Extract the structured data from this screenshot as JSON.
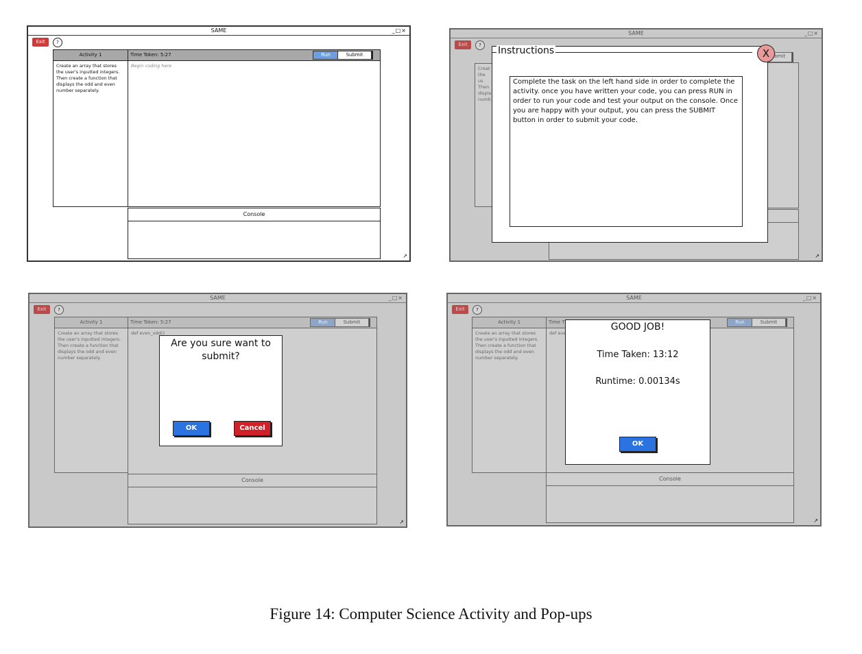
{
  "app": {
    "window_title": "SAME",
    "window_controls": "_□×",
    "exit_label": "Exit",
    "help_label": "?",
    "activity_title": "Activity 1",
    "time_token": "Time Token: 5:27",
    "run_label": "Run",
    "submit_label": "Submit",
    "task_text": "Create an array that stores the user's inputted integers. Then create a function that displays the odd and even number separately.",
    "code_placeholder": "Begin coding here",
    "code_typed": "def even_odd()",
    "console_label": "Console",
    "resize_glyph": "↗"
  },
  "instructions_popup": {
    "title": "Instructions",
    "close_glyph": "X",
    "submit_fragment": "ubmit",
    "body": "Complete the task on the left hand side in order to complete the activity. once you have written your code, you can press RUN in order to run your code and test your output on the console. Once you are happy with your output, you can press the SUBMIT button in order to submit your code.",
    "task_fragment": "Creat the us Then displa numb"
  },
  "confirm_popup": {
    "message": "Are you sure want to submit?",
    "ok_label": "OK",
    "cancel_label": "Cancel",
    "code_fragment": "def even_odd()"
  },
  "result_popup": {
    "title": "GOOD JOB!",
    "time_taken": "Time Taken: 13:12",
    "runtime": "Runtime: 0.00134s",
    "ok_label": "OK",
    "time_fragment": "Time T",
    "code_fragment": "def eve"
  },
  "caption": "Figure 14: Computer Science Activity and Pop-ups",
  "colors": {
    "exit": "#d23a3a",
    "run": "#6c9ee0",
    "ok": "#2a73e0",
    "cancel": "#d0202a",
    "close": "#e89a9a",
    "dim_background": "#c9c9c9"
  }
}
